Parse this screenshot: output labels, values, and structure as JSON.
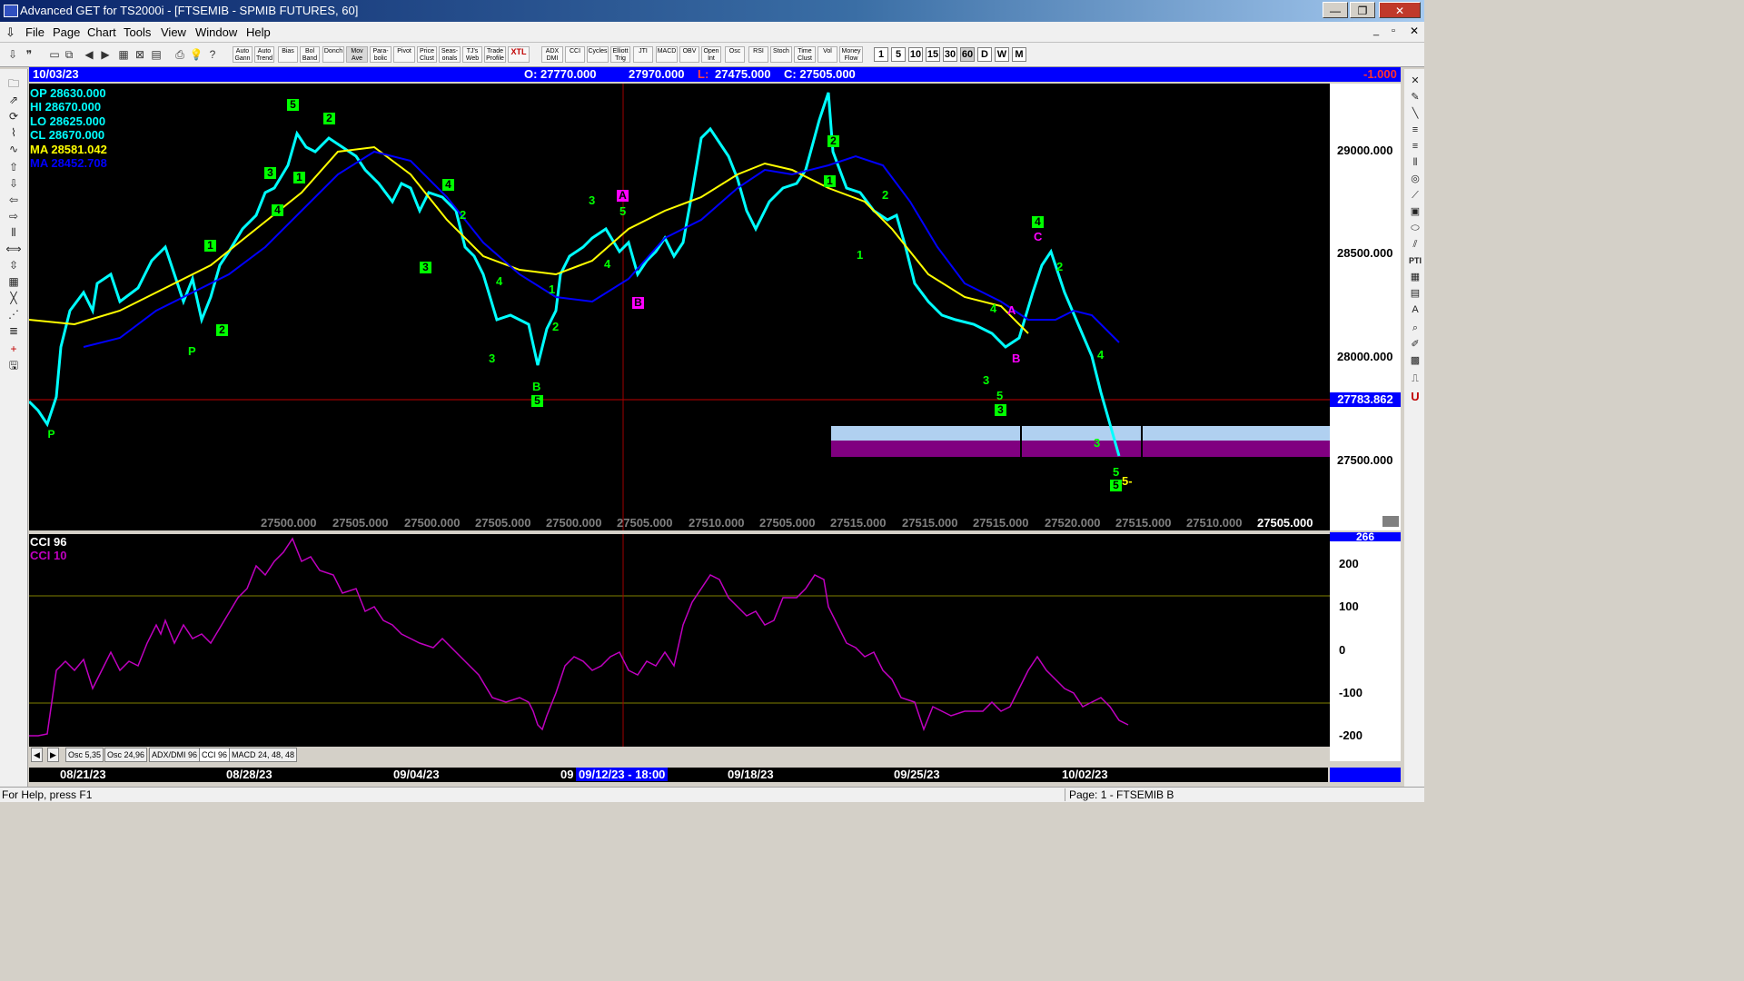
{
  "titlebar": {
    "title": "Advanced GET for TS2000i - [FTSEMIB - SPMIB FUTURES, 60]",
    "min": "—",
    "max": "❐",
    "close": "✕"
  },
  "menu": [
    "File",
    "Page",
    "Chart",
    "Tools",
    "View",
    "Window",
    "Help"
  ],
  "toolbar": {
    "tools": [
      "Auto Gann",
      "Auto Trend",
      "Bias",
      "Bol Band",
      "Donch",
      "Mov Ave",
      "Para-bolic",
      "Pivot",
      "Price Clust",
      "Seas-onals",
      "TJ's Web",
      "Trade Profile",
      "XTL",
      "ADX DMI",
      "CCI",
      "Cycles",
      "Elliott Trig",
      "JTI",
      "MACD",
      "OBV",
      "Open Int",
      "Osc",
      "RSI",
      "Stoch",
      "Time Clust",
      "Vol",
      "Money Flow"
    ],
    "intervals": [
      "1",
      "5",
      "10",
      "15",
      "30",
      "60",
      "D",
      "W",
      "M"
    ]
  },
  "infobar": {
    "date": "10/03/23",
    "open": "O: 27770.000",
    "high": "27970.000",
    "low_label": "L:",
    "low": "27475.000",
    "close": "C: 27505.000",
    "change": "-1.000"
  },
  "legend": {
    "op": "OP  28630.000",
    "hi": "HI   28670.000",
    "lo": "LO  28625.000",
    "cl": "CL  28670.000",
    "ma1": "MA  28581.042",
    "ma2": "MA  28452.708"
  },
  "price_scale": [
    "29000.000",
    "28500.000",
    "28000.000",
    "27500.000"
  ],
  "current_price": "27783.862",
  "bottom_prices": [
    "27500.000",
    "27505.000",
    "27500.000",
    "27505.000",
    "27500.000",
    "27505.000",
    "27510.000",
    "27505.000",
    "27515.000",
    "27515.000",
    "27515.000",
    "27520.000",
    "27515.000",
    "27510.000",
    "27505.000"
  ],
  "cci": {
    "label1": "CCI 96",
    "label2": "CCI  10",
    "top_value": "266",
    "scale": [
      "200",
      "100",
      "0",
      "-100",
      "-200"
    ]
  },
  "tabs": [
    "Osc 5,35",
    "Osc 24,96",
    "ADX/DMI 96",
    "CCI 96",
    "MACD 24, 48, 48"
  ],
  "dates": [
    "08/21/23",
    "08/28/23",
    "09/04/23",
    "09",
    "09/12/23 - 18:00",
    "09/18/23",
    "09/25/23",
    "10/02/23"
  ],
  "status": {
    "help": "For Help, press F1",
    "page": "Page: 1 - FTSEMIB B"
  },
  "colors": {
    "ma_yellow": "#ffff00",
    "ma_blue": "#0000ff",
    "price_cyan": "#00ffff",
    "cci_magenta": "#c000c0",
    "wave_green": "#00ff00"
  },
  "waves": [
    "5",
    "2",
    "3",
    "1",
    "4",
    "1",
    "2",
    "P",
    "2",
    "4",
    "3",
    "4",
    "3",
    "1",
    "2",
    "B",
    "5",
    "3",
    "A",
    "5",
    "4",
    "B",
    "2",
    "1",
    "2",
    "1",
    "4",
    "C",
    "2",
    "4",
    "A",
    "B",
    "3",
    "5",
    "3",
    "4",
    "3",
    "5",
    "5",
    "5-",
    "P"
  ]
}
